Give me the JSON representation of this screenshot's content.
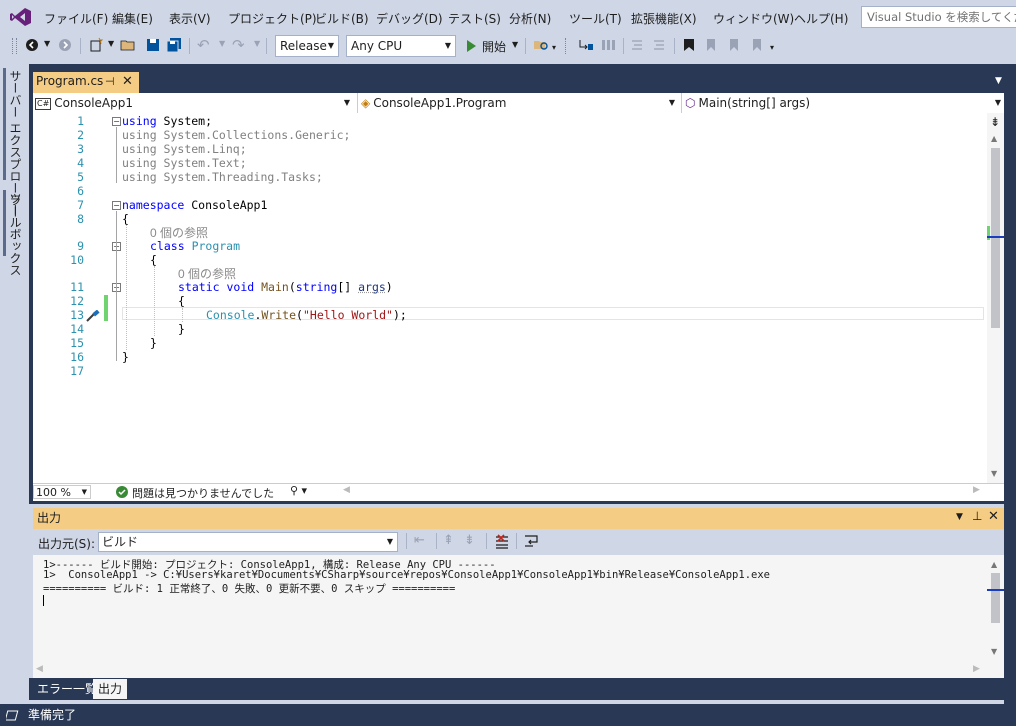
{
  "menubar": {
    "items": [
      "ファイル(F)",
      "編集(E)",
      "表示(V)",
      "プロジェクト(P)",
      "ビルド(B)",
      "デバッグ(D)",
      "テスト(S)",
      "分析(N)",
      "ツール(T)",
      "拡張機能(X)",
      "ウィンドウ(W)",
      "ヘルプ(H)"
    ],
    "search_placeholder": "Visual Studio を検索してください"
  },
  "toolbar": {
    "config_value": "Release",
    "platform_value": "Any CPU",
    "start_label": "開始"
  },
  "side_tabs": [
    "サーバー エクスプローラー",
    "ツールボックス"
  ],
  "editor": {
    "tab_label": "Program.cs",
    "nav_project": "ConsoleApp1",
    "nav_project_badge": "C#",
    "nav_class": "ConsoleApp1.Program",
    "nav_member": "Main(string[] args)",
    "line_numbers": [
      "1",
      "2",
      "3",
      "4",
      "5",
      "6",
      "7",
      "8",
      "9",
      "10",
      "11",
      "12",
      "13",
      "14",
      "15",
      "16",
      "17"
    ],
    "code": {
      "using": "using",
      "l1": " System;",
      "l2": " System.Collections.Generic;",
      "l3": " System.Linq;",
      "l4": " System.Text;",
      "l5": " System.Threading.Tasks;",
      "namespace_kw": "namespace",
      "namespace_name": " ConsoleApp1",
      "open_brace": "{",
      "close_brace": "}",
      "codelens": "0 個の参照",
      "class_kw": "class",
      "class_name": "Program",
      "static_kw": "static",
      "void_kw": "void",
      "main_name": "Main",
      "string_kw": "string",
      "main_sig_rest": "[] ",
      "args_param": "args",
      "close_paren": ")",
      "open_paren": "(",
      "console_type": "Console",
      "dot": ".",
      "write_method": "Write",
      "hello_str": "\"Hello World\"",
      "end_call": ");"
    },
    "zoom": "100 %",
    "issues_text": "問題は見つかりませんでした"
  },
  "output": {
    "title": "出力",
    "source_label": "出力元(S):",
    "source_value": "ビルド",
    "lines": [
      "1>------ ビルド開始: プロジェクト: ConsoleApp1, 構成: Release Any CPU ------",
      "1>  ConsoleApp1 -> C:¥Users¥karet¥Documents¥CSharp¥source¥repos¥ConsoleApp1¥ConsoleApp1¥bin¥Release¥ConsoleApp1.exe",
      "========== ビルド: 1 正常終了、0 失敗、0 更新不要、0 スキップ =========="
    ],
    "tabs": [
      "エラー一覧",
      "出力"
    ]
  },
  "statusbar": {
    "text": "準備完了"
  },
  "colors": {
    "accent_tab": "#f5cc84",
    "dark_frame": "#293955",
    "chrome": "#cfd6e5",
    "changed_margin": "#6fd36f"
  }
}
